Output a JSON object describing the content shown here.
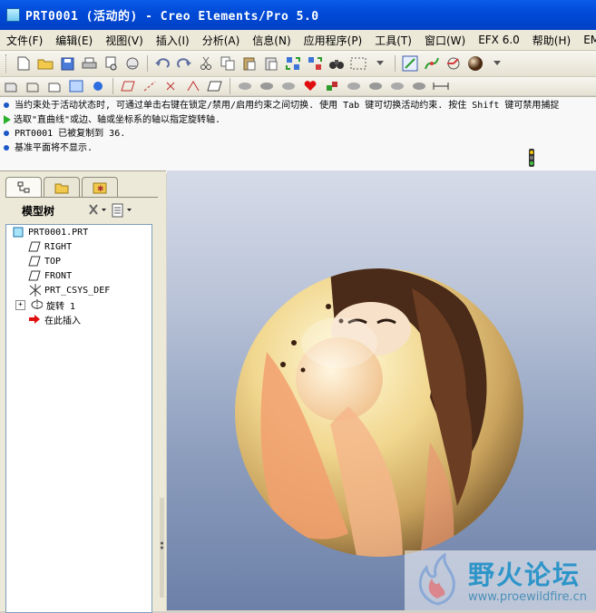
{
  "window": {
    "title": "PRT0001 (活动的) - Creo Elements/Pro 5.0"
  },
  "menu": [
    {
      "label": "文件(F)"
    },
    {
      "label": "编辑(E)"
    },
    {
      "label": "视图(V)"
    },
    {
      "label": "插入(I)"
    },
    {
      "label": "分析(A)"
    },
    {
      "label": "信息(N)"
    },
    {
      "label": "应用程序(P)"
    },
    {
      "label": "工具(T)"
    },
    {
      "label": "窗口(W)"
    },
    {
      "label": "EFX 6.0"
    },
    {
      "label": "帮助(H)"
    },
    {
      "label": "EM"
    }
  ],
  "messages": [
    "当约束处于活动状态时, 可通过单击右键在锁定/禁用/启用约束之间切换. 使用 Tab 键可切换活动约束. 按住 Shift 键可禁用捕捉",
    "选取\"直曲线\"或边、轴或坐标系的轴以指定旋转轴.",
    "PRT0001 已被复制到 36.",
    "基准平面将不显示."
  ],
  "model_tree": {
    "title": "模型树",
    "items": [
      {
        "label": "PRT0001.PRT",
        "icon": "part-icon"
      },
      {
        "label": "RIGHT",
        "icon": "datum-plane-icon"
      },
      {
        "label": "TOP",
        "icon": "datum-plane-icon"
      },
      {
        "label": "FRONT",
        "icon": "datum-plane-icon"
      },
      {
        "label": "PRT_CSYS_DEF",
        "icon": "csys-icon"
      },
      {
        "label": "旋转 1",
        "icon": "revolve-icon"
      },
      {
        "label": "在此插入",
        "icon": "insert-here-icon"
      }
    ]
  },
  "watermark": {
    "title": "野火论坛",
    "url": "www.proewildfire.cn"
  },
  "colors": {
    "titlebar": "#0a5ce9",
    "panel": "#ece9d8",
    "viewport_top": "#d6dbe8",
    "viewport_bottom": "#6c80a8",
    "watermark": "#2e95c9"
  }
}
